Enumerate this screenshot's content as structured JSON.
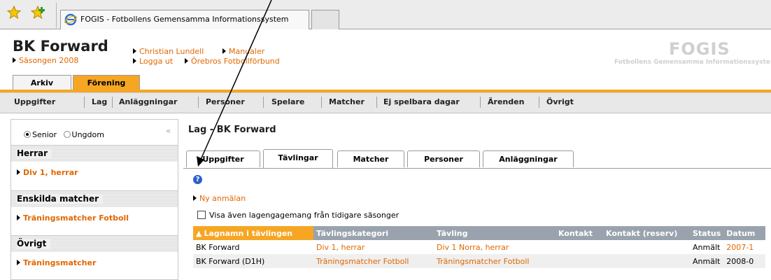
{
  "browser": {
    "tab_title": "FOGIS - Fotbollens Gemensamma Informationssystem"
  },
  "header": {
    "club_name": "BK Forward",
    "season": "Säsongen 2008",
    "user": "Christian Lundell",
    "manual": "Manualer",
    "logout": "Logga ut",
    "federation": "Örebros Fotbollförbund",
    "logo": "FOGIS",
    "logo_sub": "Fotbollens Gemensamma Informationssyste"
  },
  "main_tabs": [
    {
      "label": "Arkiv",
      "active": false
    },
    {
      "label": "Förening",
      "active": true
    }
  ],
  "subnav": [
    "Uppgifter",
    "Lag",
    "Anläggningar",
    "Personer",
    "Spelare",
    "Matcher",
    "Ej spelbara dagar",
    "Ärenden",
    "Övrigt"
  ],
  "sidebar": {
    "radio": {
      "senior": "Senior",
      "youth": "Ungdom",
      "selected": "Senior"
    },
    "collapse": "«",
    "sections": [
      {
        "title": "Herrar",
        "items": [
          "Div 1, herrar"
        ]
      },
      {
        "title": "Enskilda matcher",
        "items": [
          "Träningsmatcher Fotboll"
        ]
      },
      {
        "title": "Övrigt",
        "items": [
          "Träningsmatcher"
        ]
      }
    ]
  },
  "content": {
    "title": "Lag - BK Forward",
    "tabs": [
      "Uppgifter",
      "Tävlingar",
      "Matcher",
      "Personer",
      "Anläggningar"
    ],
    "active_tab": "Tävlingar",
    "help": "?",
    "new_entry": "Ny anmälan",
    "show_previous": "Visa även lagengagemang från tidigare säsonger",
    "table": {
      "headers": [
        "Lagnamn i tävlingen",
        "Tävlingskategori",
        "Tävling",
        "Kontakt",
        "Kontakt (reserv)",
        "Status",
        "Datum"
      ],
      "rows": [
        [
          "BK Forward",
          "Div 1, herrar",
          "Div 1 Norra, herrar",
          "",
          "",
          "Anmält",
          "2007-1"
        ],
        [
          "BK Forward (D1H)",
          "Träningsmatcher Fotboll",
          "Träningsmatcher Fotboll",
          "",
          "",
          "Anmält",
          "2008-0"
        ]
      ]
    }
  },
  "colors": {
    "accent": "#f6a623",
    "link": "#e06800",
    "table_header": "#9aa3ad"
  }
}
